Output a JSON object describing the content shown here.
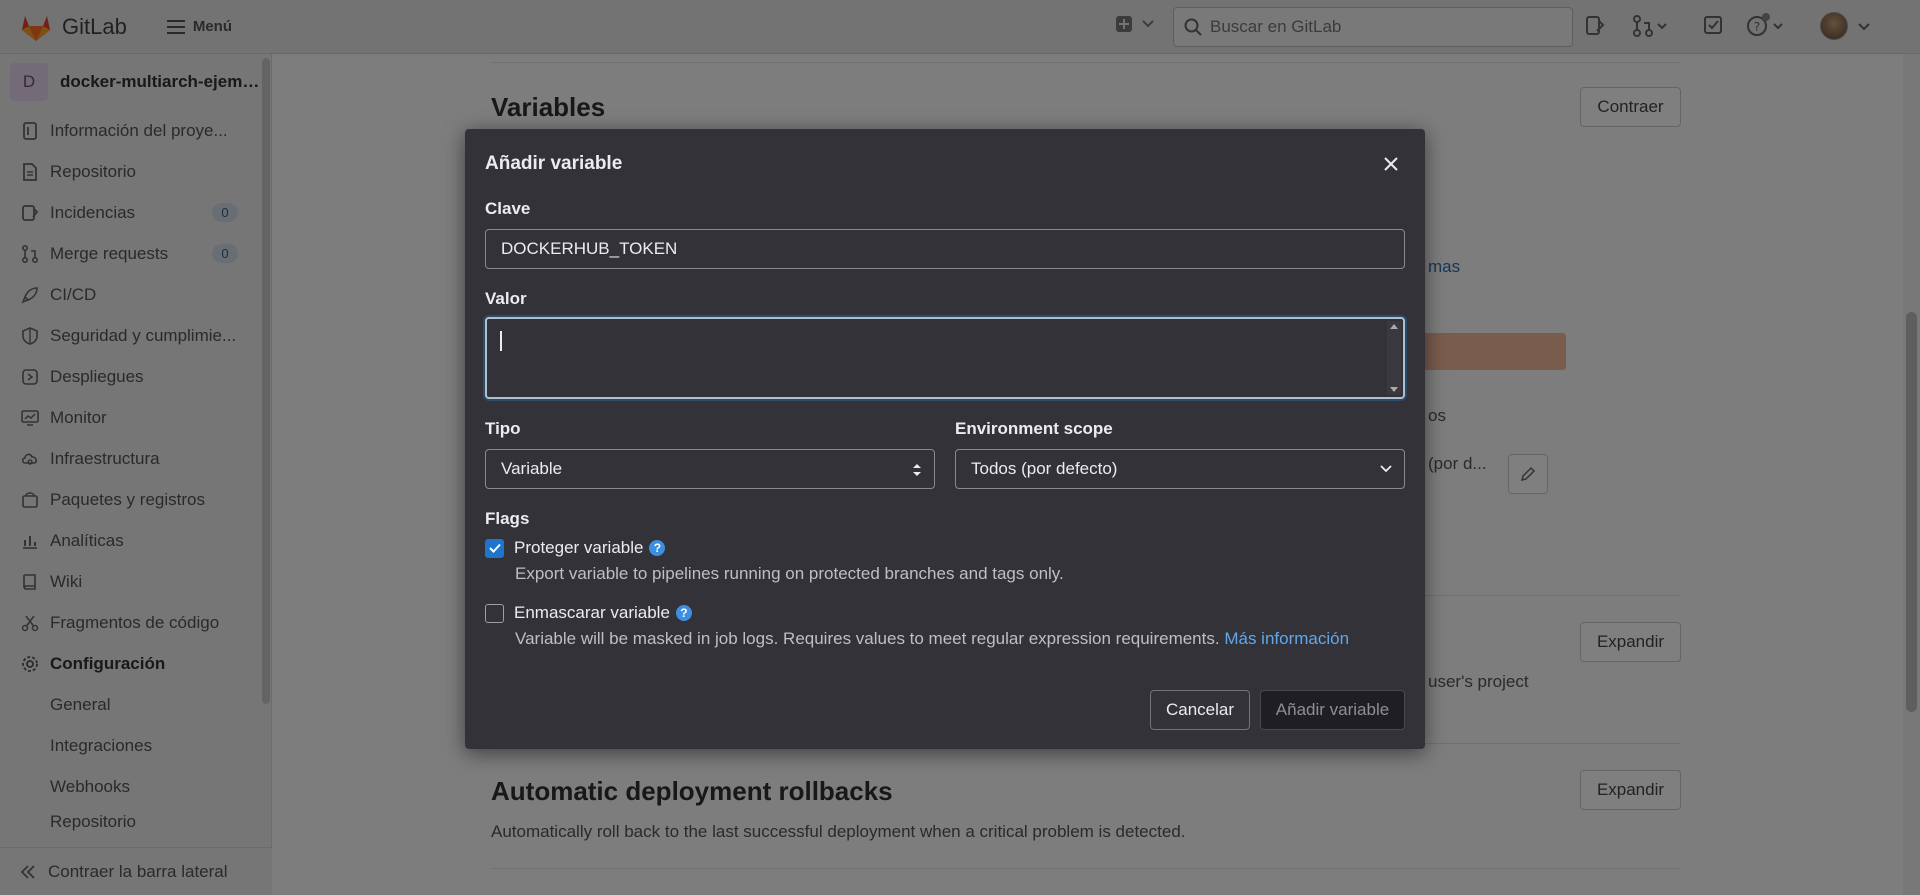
{
  "navbar": {
    "logo_text": "GitLab",
    "menu_label": "Menú",
    "search_placeholder": "Buscar en GitLab"
  },
  "sidebar": {
    "project_initial": "D",
    "project_name": "docker-multiarch-ejemp...",
    "items": [
      {
        "label": "Información del proye...",
        "icon": "info-icon"
      },
      {
        "label": "Repositorio",
        "icon": "doc-icon"
      },
      {
        "label": "Incidencias",
        "icon": "issues-icon",
        "count": "0"
      },
      {
        "label": "Merge requests",
        "icon": "merge-icon",
        "count": "0"
      },
      {
        "label": "CI/CD",
        "icon": "rocket-icon"
      },
      {
        "label": "Seguridad y cumplimie...",
        "icon": "shield-icon"
      },
      {
        "label": "Despliegues",
        "icon": "deploy-icon"
      },
      {
        "label": "Monitor",
        "icon": "monitor-icon"
      },
      {
        "label": "Infraestructura",
        "icon": "cloud-icon"
      },
      {
        "label": "Paquetes y registros",
        "icon": "package-icon"
      },
      {
        "label": "Analíticas",
        "icon": "chart-icon"
      },
      {
        "label": "Wiki",
        "icon": "book-icon"
      },
      {
        "label": "Fragmentos de código",
        "icon": "scissors-icon"
      },
      {
        "label": "Configuración",
        "icon": "gear-icon"
      }
    ],
    "sub_items": [
      "General",
      "Integraciones",
      "Webhooks",
      "Repositorio"
    ],
    "collapse_label": "Contraer la barra lateral"
  },
  "main": {
    "variables_title": "Variables",
    "variables_button": "Contraer",
    "frag_mas": "mas",
    "frag_os": "os",
    "frag_por_d": "(por d...",
    "frag_users_project": "user's project",
    "section2_button": "Expandir",
    "rollback_title": "Automatic deployment rollbacks",
    "rollback_button": "Expandir",
    "rollback_desc": "Automatically roll back to the last successful deployment when a critical problem is detected."
  },
  "modal": {
    "title": "Añadir variable",
    "key_label": "Clave",
    "key_value": "DOCKERHUB_TOKEN",
    "value_label": "Valor",
    "value_value": "",
    "type_label": "Tipo",
    "type_value": "Variable",
    "scope_label": "Environment scope",
    "scope_value": "Todos (por defecto)",
    "flags_label": "Flags",
    "protect_label": "Proteger variable",
    "protect_checked": true,
    "protect_help": "Export variable to pipelines running on protected branches and tags only.",
    "mask_label": "Enmascarar variable",
    "mask_checked": false,
    "mask_help": "Variable will be masked in job logs. Requires values to meet regular expression requirements.",
    "mask_link": "Más información",
    "cancel_label": "Cancelar",
    "submit_label": "Añadir variable"
  },
  "colors": {
    "modal_bg": "#333238",
    "accent": "#1f75cb",
    "link": "#63a6e9"
  }
}
